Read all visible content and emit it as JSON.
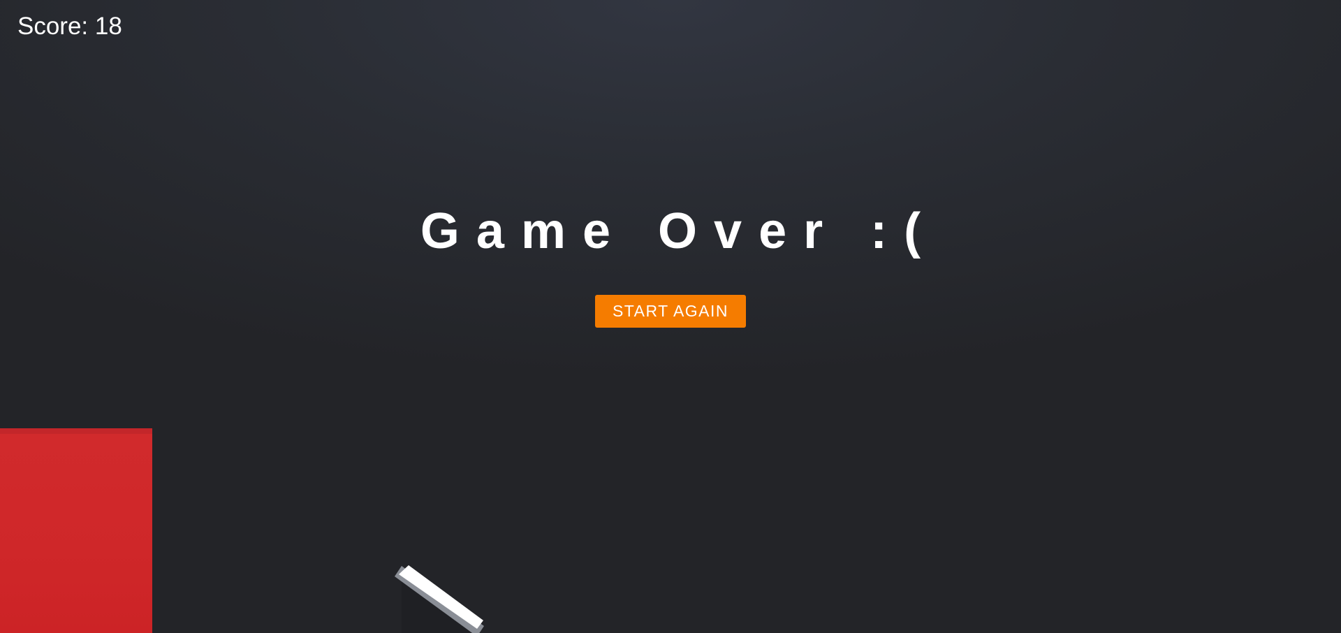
{
  "hud": {
    "score_label": "Score: 18"
  },
  "overlay": {
    "title": "Game Over :(",
    "restart_button_label": "START AGAIN"
  },
  "colors": {
    "background": "#2a2d34",
    "button": "#f57c00",
    "red_block": "#cf2729",
    "tile_top": "#ffffff",
    "tile_side": "#8a8e96"
  }
}
